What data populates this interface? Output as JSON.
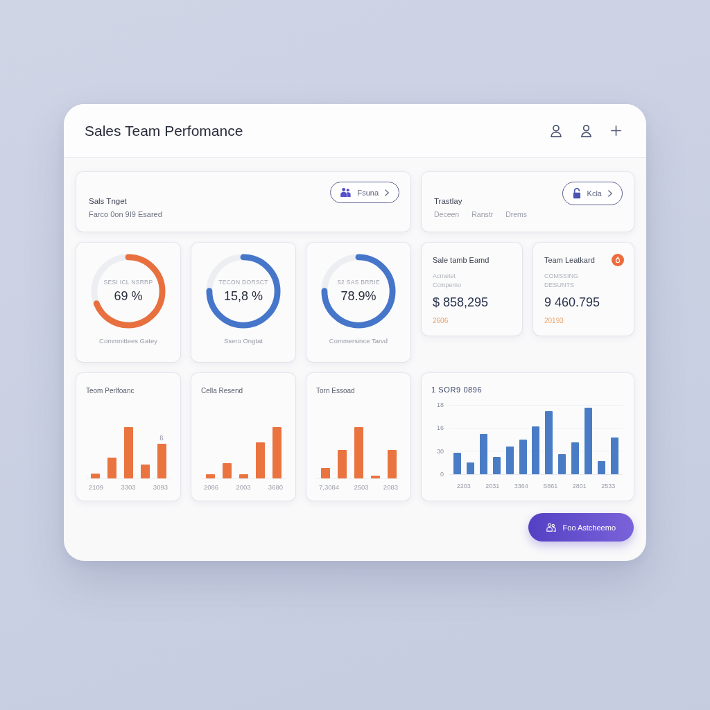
{
  "window": {
    "title": "Sales Team Perfomance"
  },
  "target_panel": {
    "title": "Sals Tnget",
    "subtitle": "Farco 0on 9I9 Esared",
    "button": {
      "label": "Fsuna"
    }
  },
  "tab_panel": {
    "title": "Trastlay",
    "tabs": [
      {
        "label": "Deceen",
        "selected": false
      },
      {
        "label": "Ranstr",
        "selected": false
      },
      {
        "label": "Drems",
        "selected": false
      }
    ],
    "button": {
      "label": "Kcla"
    }
  },
  "gauges": [
    {
      "label": "SESI ICL NSRRP",
      "value": "69 %",
      "caption": "Commnittees Gatey",
      "level": 0.69,
      "color": "#e8703f"
    },
    {
      "label": "TECON DORSCT",
      "value": "15,8 %",
      "caption": "Ssero Ongtat",
      "level": 0.75,
      "color": "#4676c9"
    },
    {
      "label": "S2 SAS BRRIE",
      "value": "78.9%",
      "caption": "Commersince Tarvd",
      "level": 0.75,
      "color": "#4676c9"
    }
  ],
  "stats": [
    {
      "title": "Sale tamb Eamd",
      "notes": [
        "Acmetet",
        "Ccmpemo"
      ],
      "value": "$ 858,295",
      "footer": "2606"
    },
    {
      "title": "Team Leatkard",
      "notes": [
        "COMSSING",
        "DESUNTS"
      ],
      "value": "9 460.795",
      "footer": "20193",
      "badge": true
    }
  ],
  "mini_charts": [
    {
      "title": "Teom Perlfoanc",
      "labels": [
        "2109",
        "3303",
        "3093"
      ],
      "note": "ß"
    },
    {
      "title": "Cella Resend",
      "labels": [
        "2086",
        "2003",
        "3680"
      ]
    },
    {
      "title": "Torn Essoad",
      "labels": [
        "7,3084",
        "2503",
        "2083"
      ]
    }
  ],
  "main_chart": {
    "title": "1 SOR9 0896",
    "y_labels": [
      "18",
      "16",
      "30",
      "0"
    ],
    "x_labels": [
      "2203",
      "2031",
      "3364",
      "S861",
      "2801",
      "2533"
    ]
  },
  "action_button": {
    "label": "Foo Astcheemo"
  }
}
